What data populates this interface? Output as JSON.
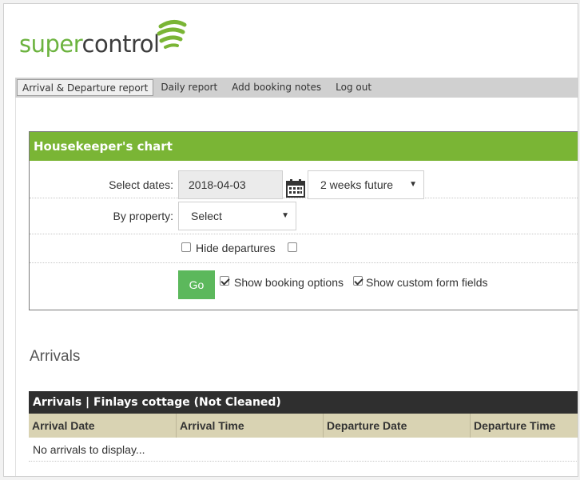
{
  "logo": {
    "part1": "super",
    "part2": "control"
  },
  "nav": {
    "tabs": [
      {
        "label": "Arrival & Departure report",
        "active": true
      },
      {
        "label": "Daily report",
        "active": false
      },
      {
        "label": "Add booking notes",
        "active": false
      },
      {
        "label": "Log out",
        "active": false
      }
    ]
  },
  "housekeeper": {
    "title": "Housekeeper's chart",
    "select_dates_label": "Select dates:",
    "date_value": "2018-04-03",
    "range_value": "2 weeks future",
    "property_label": "By property:",
    "property_value": "Select",
    "hide_departures_label": "Hide departures",
    "hide_departures_checked": false,
    "extra_checkbox_checked": false,
    "go_label": "Go",
    "show_booking_options_label": "Show booking options",
    "show_booking_options_checked": true,
    "show_custom_fields_label": "Show custom form fields",
    "show_custom_fields_checked": true
  },
  "arrivals": {
    "heading": "Arrivals",
    "table_title": "Arrivals | Finlays cottage (Not Cleaned)",
    "columns": [
      "Arrival Date",
      "Arrival Time",
      "Departure Date",
      "Departure Time"
    ],
    "empty_message": "No arrivals to display..."
  },
  "colors": {
    "brand_green": "#7ab535",
    "go_button": "#5cb85c",
    "table_title_bg": "#2f2f2f",
    "table_head_bg": "#d9d3b3"
  }
}
